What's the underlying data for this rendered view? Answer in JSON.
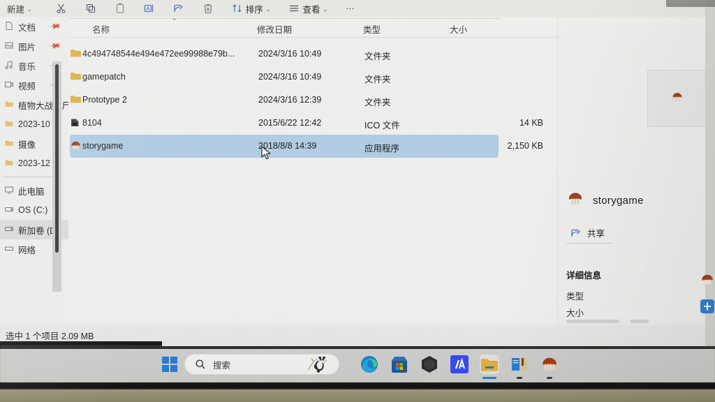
{
  "window": {
    "app": "File Explorer",
    "toolbar": {
      "new_label": "新建",
      "items": [
        {
          "name": "cut-icon",
          "label": ""
        },
        {
          "name": "copy-icon",
          "label": ""
        },
        {
          "name": "paste-icon",
          "label": ""
        },
        {
          "name": "rename-icon",
          "label": ""
        },
        {
          "name": "share-icon",
          "label": ""
        },
        {
          "name": "delete-icon",
          "label": ""
        }
      ],
      "sort_label": "排序",
      "view_label": "查看",
      "more_label": "···"
    }
  },
  "sidebar": {
    "items": [
      {
        "label": "文档",
        "pinned": "📌",
        "icon": "document-icon"
      },
      {
        "label": "图片",
        "pinned": "📌",
        "icon": "pictures-icon"
      },
      {
        "label": "音乐",
        "pinned": "📌",
        "icon": "music-icon"
      },
      {
        "label": "视频",
        "pinned": "📌",
        "icon": "videos-icon"
      },
      {
        "label": "植物大战僵尸阳",
        "pinned": "",
        "icon": "folder-icon"
      },
      {
        "label": "2023-10",
        "pinned": "",
        "icon": "folder-icon"
      },
      {
        "label": "摄像",
        "pinned": "",
        "icon": "folder-icon"
      },
      {
        "label": "2023-12",
        "pinned": "",
        "icon": "folder-icon"
      }
    ],
    "items2": [
      {
        "label": "此电脑",
        "icon": "this-pc-icon",
        "selected": false
      },
      {
        "label": "OS (C:)",
        "icon": "drive-icon",
        "selected": false
      },
      {
        "label": "新加卷 (D:)",
        "icon": "drive-icon",
        "selected": true
      },
      {
        "label": "网络",
        "icon": "network-icon",
        "selected": false
      }
    ]
  },
  "file_list": {
    "columns": [
      {
        "key": "name",
        "label": "名称",
        "sorted": "asc"
      },
      {
        "key": "date",
        "label": "修改日期"
      },
      {
        "key": "type",
        "label": "类型"
      },
      {
        "key": "size",
        "label": "大小"
      }
    ],
    "rows": [
      {
        "name": "4c494748544e494e472ee99988e79b...",
        "date": "2024/3/16 10:49",
        "type": "文件夹",
        "size": "",
        "icon": "folder-icon",
        "selected": false
      },
      {
        "name": "gamepatch",
        "date": "2024/3/16 10:49",
        "type": "文件夹",
        "size": "",
        "icon": "folder-icon",
        "selected": false
      },
      {
        "name": "Prototype 2",
        "date": "2024/3/16 12:39",
        "type": "文件夹",
        "size": "",
        "icon": "folder-icon",
        "selected": false
      },
      {
        "name": "8104",
        "date": "2015/6/22 12:42",
        "type": "ICO 文件",
        "size": "14 KB",
        "icon": "ico-file-icon",
        "selected": false
      },
      {
        "name": "storygame",
        "date": "2018/8/8 14:39",
        "type": "应用程序",
        "size": "2,150 KB",
        "icon": "mushroom-app-icon",
        "selected": true
      }
    ]
  },
  "details_pane": {
    "file_name": "storygame",
    "share_label": "共享",
    "details_heading": "详细信息",
    "field_type_label": "类型",
    "field_size_label": "大小"
  },
  "status_bar": {
    "text": "选中 1 个项目  2.09 MB"
  },
  "taskbar": {
    "start_label": "",
    "search_placeholder": "搜索",
    "apps": [
      {
        "name": "edge-icon",
        "label": "Microsoft Edge"
      },
      {
        "name": "microsoft-store-icon",
        "label": "Microsoft Store"
      },
      {
        "name": "hexagon-app-icon",
        "label": ""
      },
      {
        "name": "blue-slash-a-icon",
        "label": "//A"
      },
      {
        "name": "file-explorer-icon",
        "label": "文件资源管理器"
      },
      {
        "name": "notebook-app-icon",
        "label": ""
      },
      {
        "name": "storygame-icon",
        "label": "storygame"
      }
    ]
  },
  "colors": {
    "selection_blue": "#b0d0ea",
    "accent_blue": "#2a7fd4",
    "window_bg": "#f1f1ef",
    "taskbar_bg": "#d4d4d2",
    "folder_yellow": "#e8b33d",
    "mushroom_red": "#a43b16"
  }
}
